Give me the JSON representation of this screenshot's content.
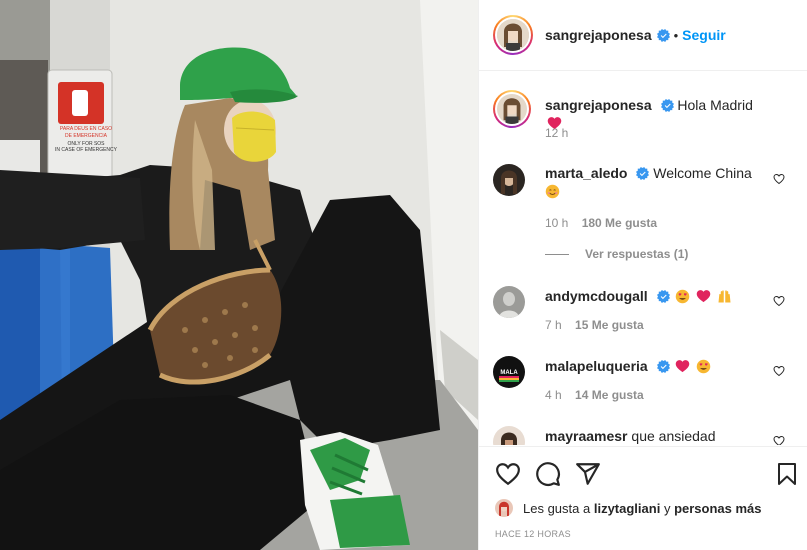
{
  "header": {
    "username": "sangrejaponesa",
    "dot": "•",
    "follow_label": "Seguir"
  },
  "caption": {
    "username": "sangrejaponesa",
    "text": "Hola Madrid",
    "time": "12 h"
  },
  "comments": [
    {
      "username": "marta_aledo",
      "text": "Welcome China",
      "time": "10 h",
      "likes": "180 Me gusta",
      "verified": true
    },
    {
      "username": "andymcdougall",
      "text": "",
      "time": "7 h",
      "likes": "15 Me gusta",
      "verified": true
    },
    {
      "username": "malapeluqueria",
      "text": "",
      "time": "4 h",
      "likes": "14 Me gusta",
      "verified": true
    },
    {
      "username": "mayraamesr",
      "text": "que ansiedad",
      "time": "",
      "likes": "",
      "verified": false
    }
  ],
  "replies": {
    "label": "Ver respuestas (1)"
  },
  "likes": {
    "prefix": "Les gusta a",
    "user": "lizytagliani",
    "middle": "y",
    "others": "personas más"
  },
  "post_time": "HACE 12 HORAS",
  "colors": {
    "accent": "#0095f6",
    "verified": "#3897f0",
    "text": "#262626",
    "muted": "#8e8e8e"
  },
  "photo_sign": {
    "line1": "PARA DEUS EN CASO",
    "line2": "DE EMERGENCIA",
    "line3": "ONLY FOR SOS",
    "line4": "IN CASE OF EMERGENCY"
  }
}
